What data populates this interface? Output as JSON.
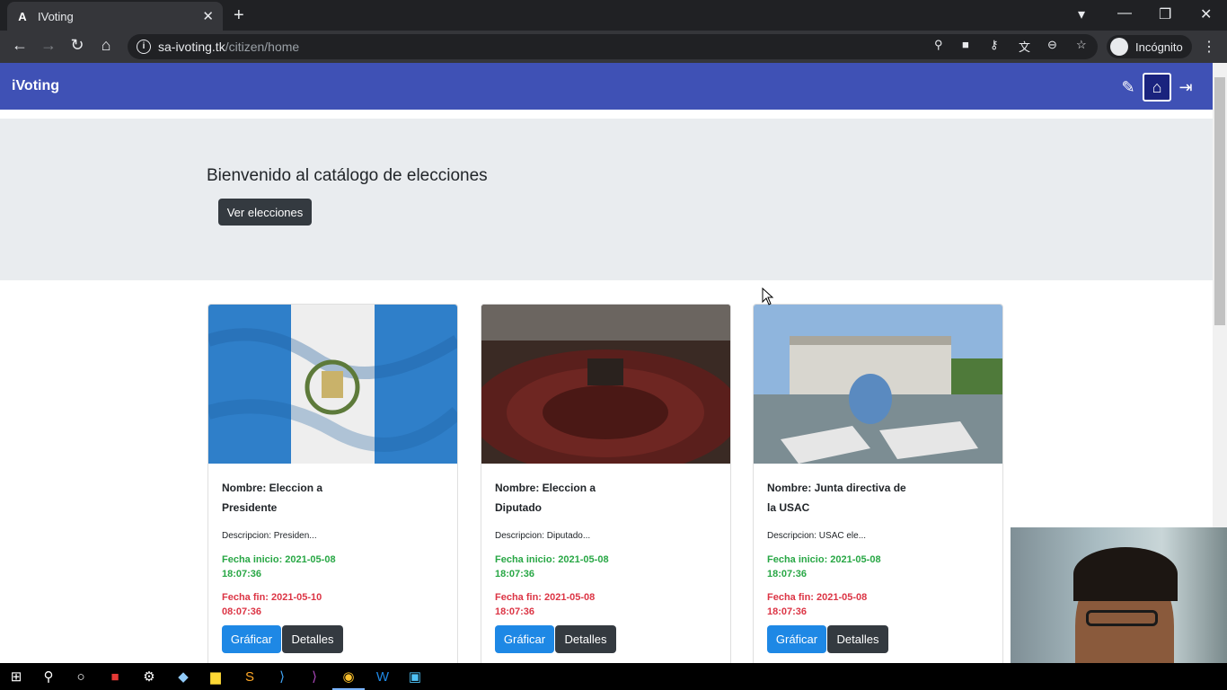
{
  "browser": {
    "tab_title": "IVoting",
    "tab_icon": "angular-logo-icon",
    "url_domain": "sa-ivoting.tk",
    "url_path": "/citizen/home",
    "profile_label": "Incógnito"
  },
  "app": {
    "brand": "iVoting",
    "header_color": "#3f51b5"
  },
  "hero": {
    "title": "Bienvenido al catálogo de elecciones",
    "button": "Ver elecciones"
  },
  "cards": [
    {
      "name": "Nombre: Eleccion a Presidente",
      "description": "Descripcion: Presiden...",
      "start": "Fecha inicio: 2021-05-08 18:07:36",
      "end": "Fecha fin: 2021-05-10 08:07:36",
      "chart_button": "Gráficar",
      "details_button": "Detalles",
      "image": "guatemala-flag"
    },
    {
      "name": "Nombre: Eleccion a Diputado",
      "description": "Descripcion: Diputado...",
      "start": "Fecha inicio: 2021-05-08 18:07:36",
      "end": "Fecha fin: 2021-05-08 18:07:36",
      "chart_button": "Gráficar",
      "details_button": "Detalles",
      "image": "congress-chamber"
    },
    {
      "name": "Nombre: Junta directiva de la USAC",
      "description": "Descripcion: USAC ele...",
      "start": "Fecha inicio: 2021-05-08 18:07:36",
      "end": "Fecha fin: 2021-05-08 18:07:36",
      "chart_button": "Gráficar",
      "details_button": "Detalles",
      "image": "usac-building"
    }
  ],
  "colors": {
    "start_date": "#28a745",
    "end_date": "#dc3545",
    "primary": "#1e88e5",
    "dark": "#343a40"
  }
}
